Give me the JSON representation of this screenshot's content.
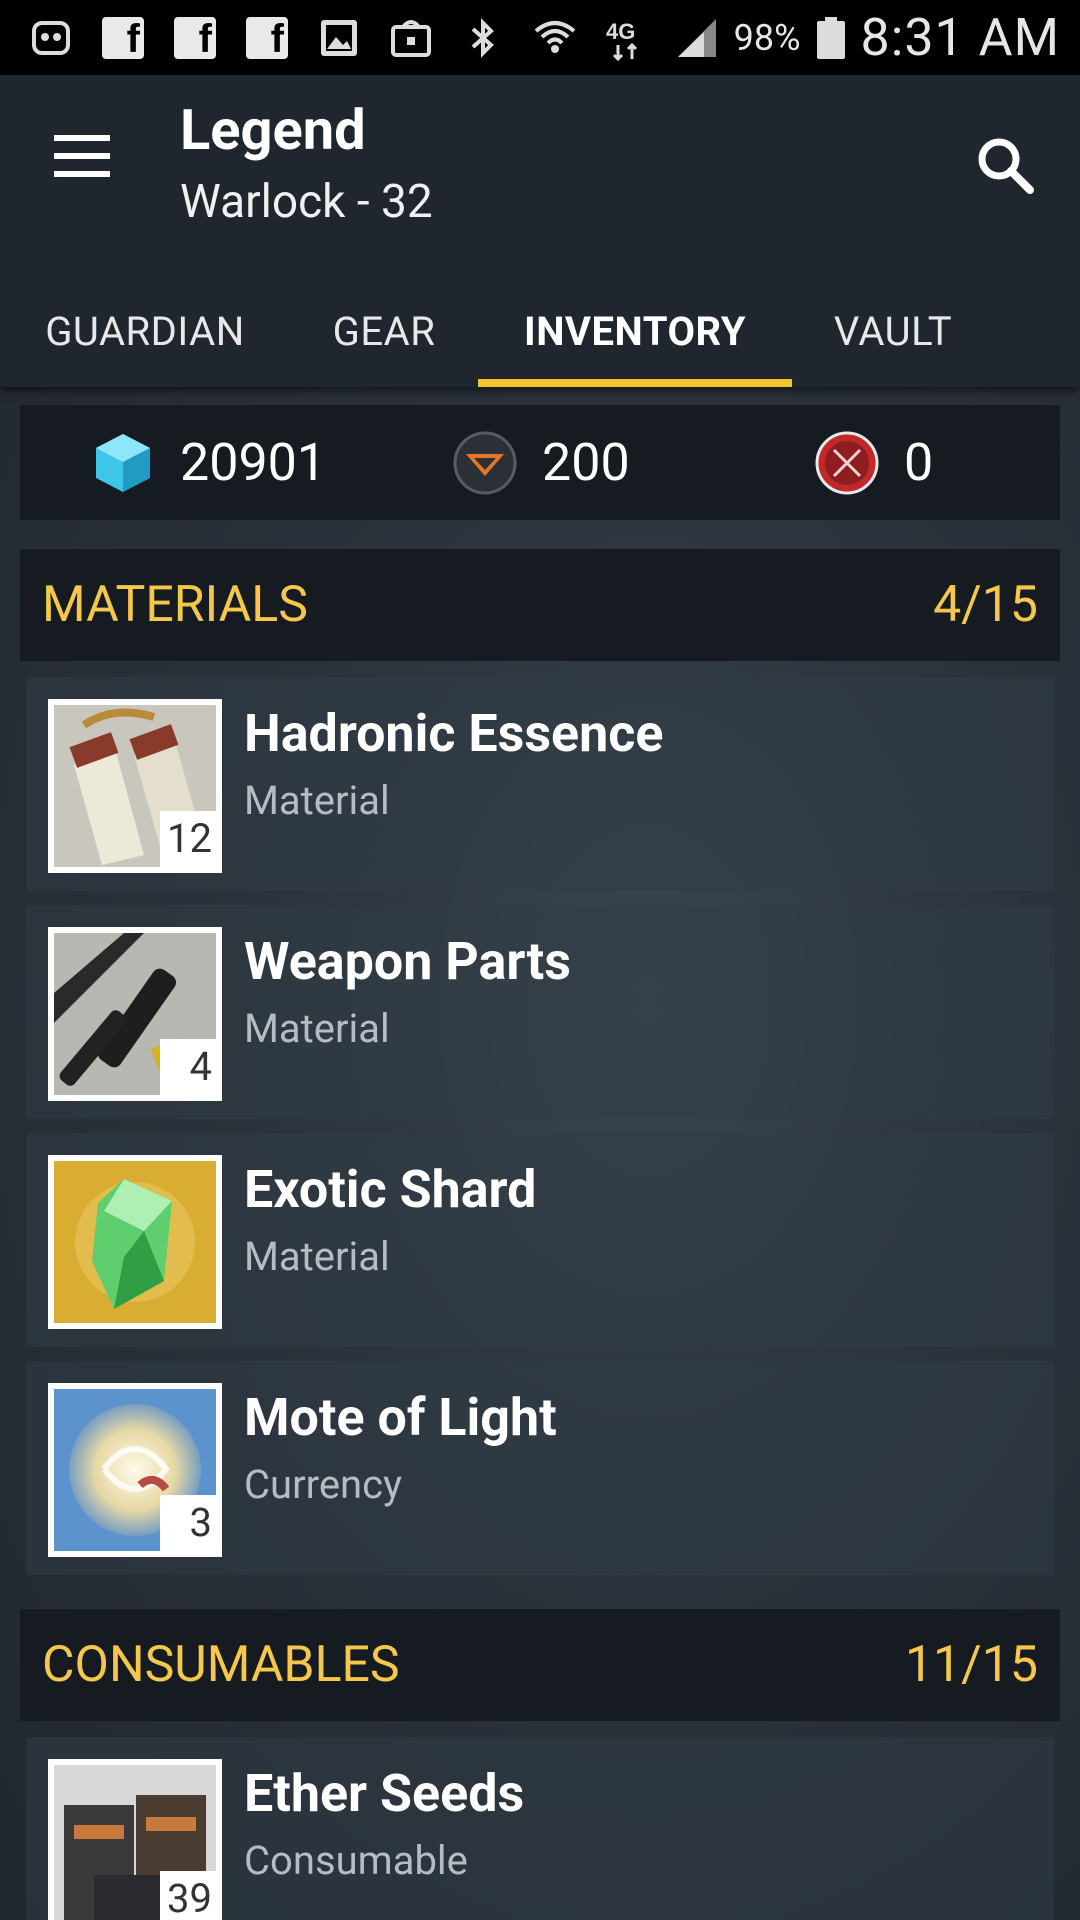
{
  "status_bar": {
    "battery": "98%",
    "time": "8:31 AM",
    "network": "4G LTE"
  },
  "app_bar": {
    "title": "Legend",
    "subtitle": "Warlock - 32"
  },
  "tabs": [
    {
      "label": "GUARDIAN"
    },
    {
      "label": "GEAR"
    },
    {
      "label": "INVENTORY"
    },
    {
      "label": "VAULT"
    }
  ],
  "currencies": [
    {
      "icon": "glimmer-icon",
      "value": "20901"
    },
    {
      "icon": "vanguard-marks-icon",
      "value": "200"
    },
    {
      "icon": "crucible-marks-icon",
      "value": "0"
    }
  ],
  "sections": {
    "materials": {
      "title": "MATERIALS",
      "count": "4/15"
    },
    "consumables": {
      "title": "CONSUMABLES",
      "count": "11/15"
    }
  },
  "materials": [
    {
      "name": "Hadronic Essence",
      "type": "Material",
      "qty": "12",
      "icon": "hadronic-essence-icon"
    },
    {
      "name": "Weapon Parts",
      "type": "Material",
      "qty": "4",
      "icon": "weapon-parts-icon"
    },
    {
      "name": "Exotic Shard",
      "type": "Material",
      "qty": "",
      "icon": "exotic-shard-icon"
    },
    {
      "name": "Mote of Light",
      "type": "Currency",
      "qty": "3",
      "icon": "mote-of-light-icon"
    }
  ],
  "consumables": [
    {
      "name": "Ether Seeds",
      "type": "Consumable",
      "qty": "39",
      "icon": "ether-seeds-icon"
    }
  ],
  "colors": {
    "accent": "#f4c430",
    "section_text": "#f5c84b",
    "background": "#1c2329"
  }
}
